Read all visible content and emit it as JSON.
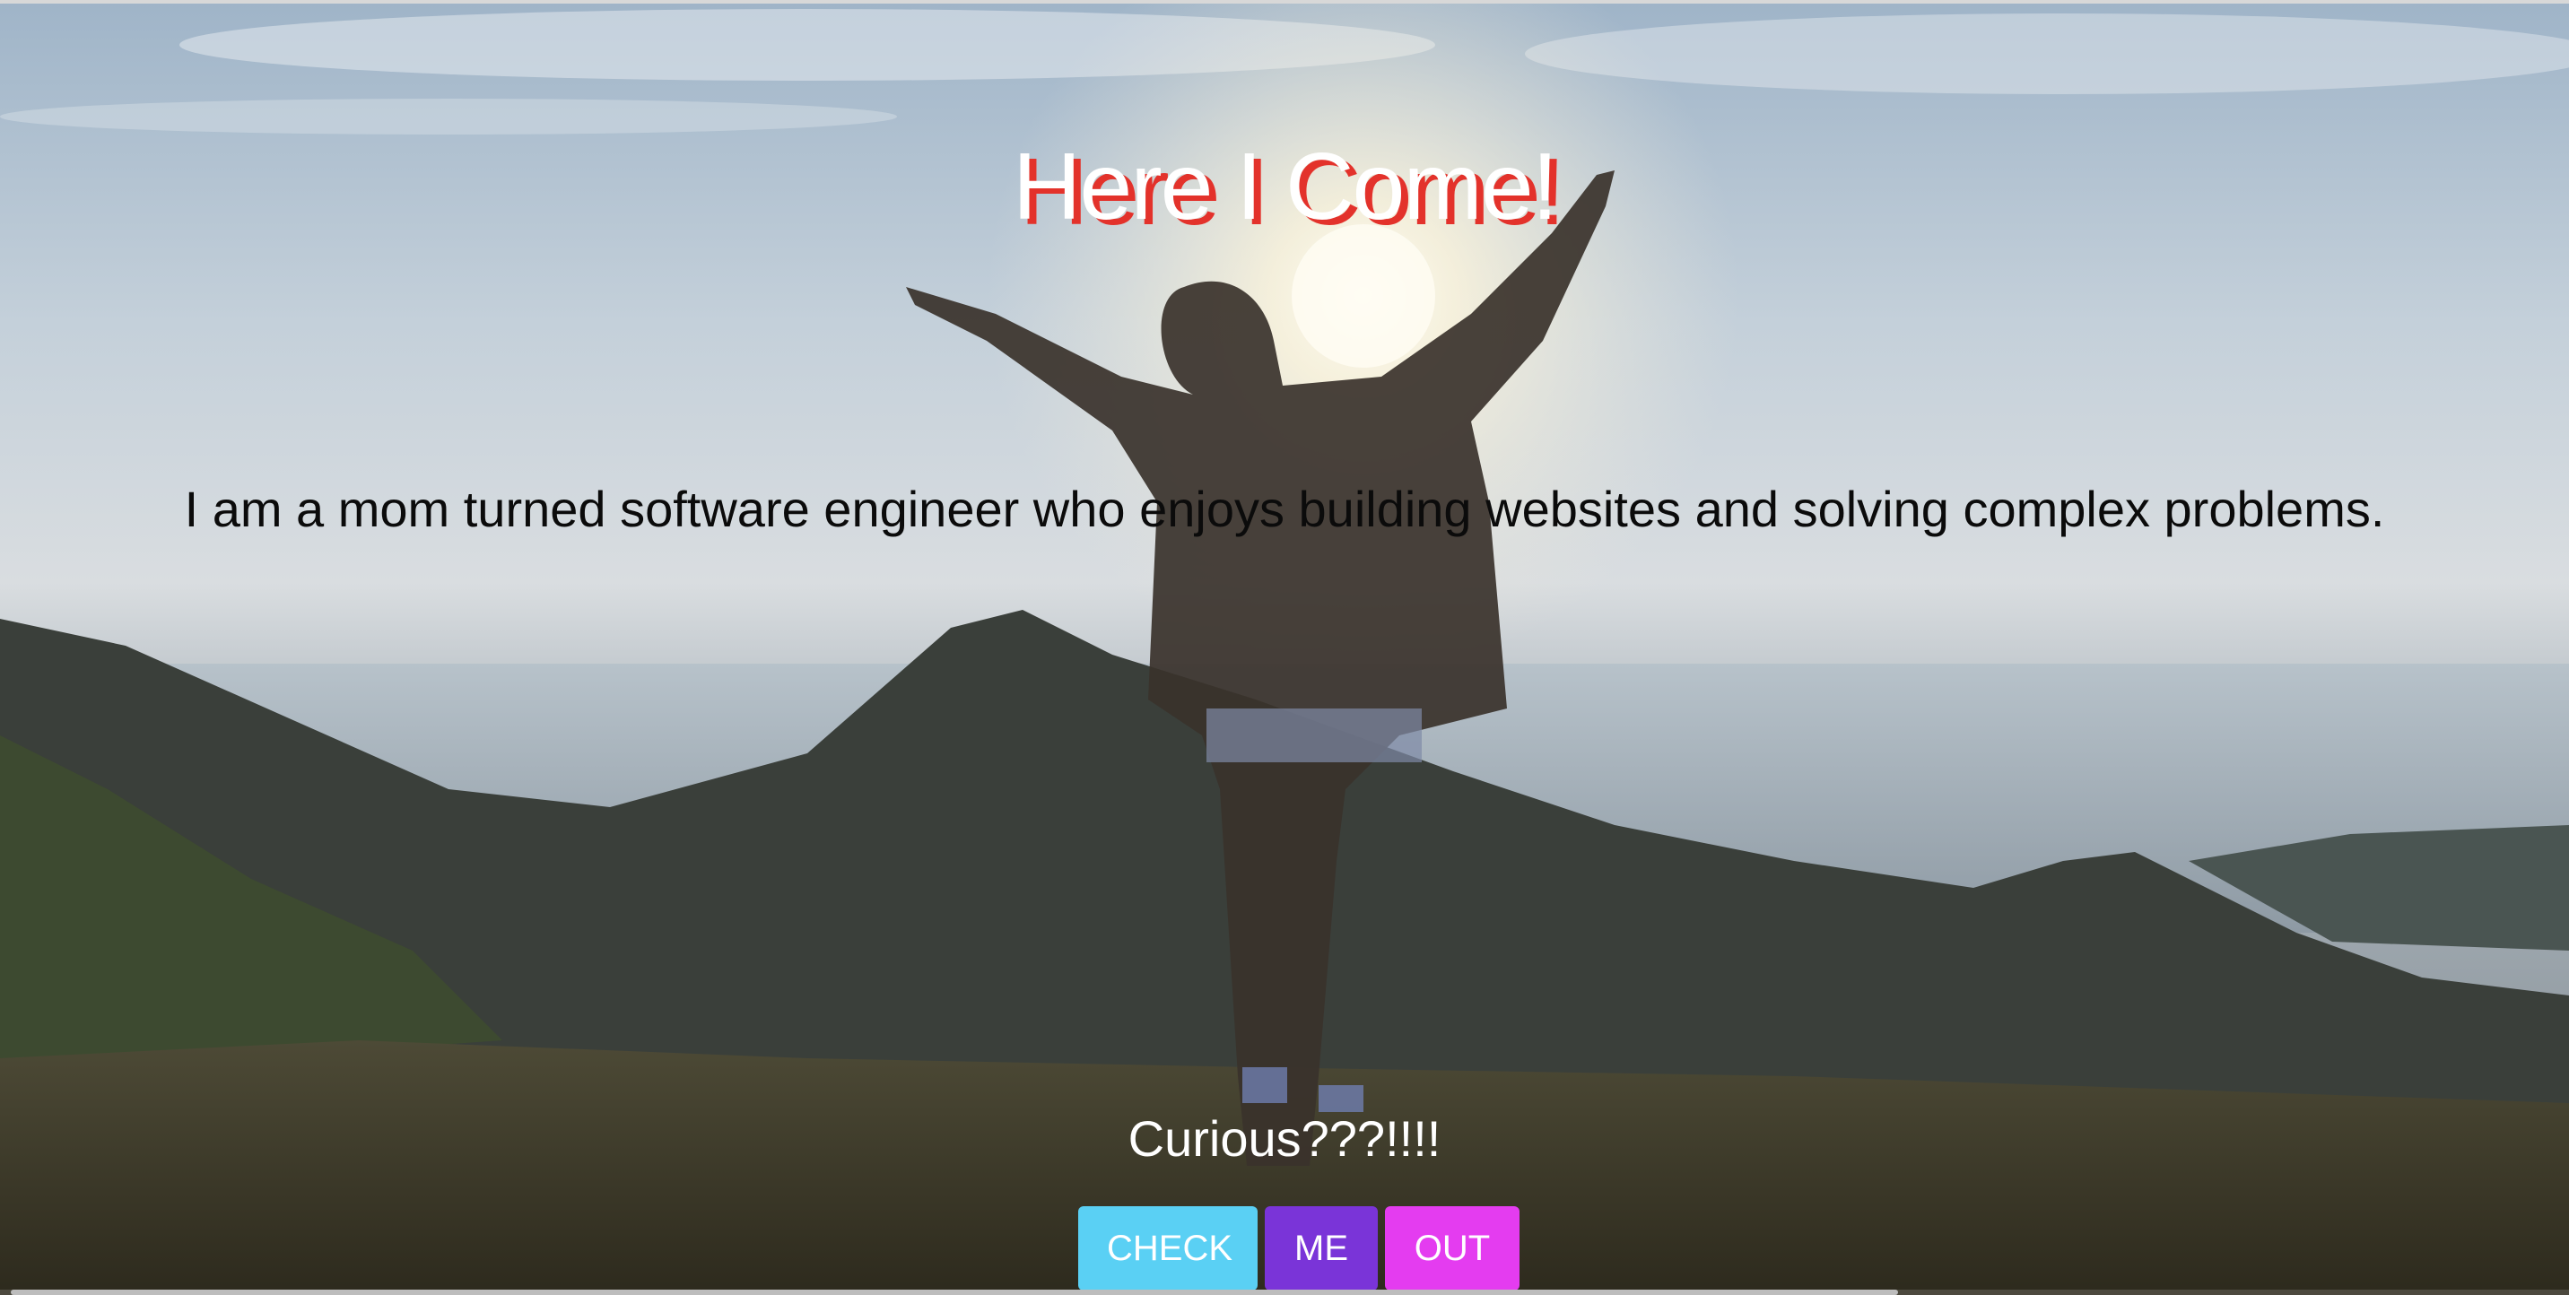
{
  "hero": {
    "headline": "Here I Come!",
    "bio": "I am a mom turned software engineer who enjoys building websites and solving complex problems.",
    "curious": "Curious???!!!!",
    "image_description_icon": "mountain-sunrise-photo"
  },
  "buttons": [
    {
      "label": "CHECK",
      "color": "#5ad0f4"
    },
    {
      "label": "ME",
      "color": "#7a34d8"
    },
    {
      "label": "OUT",
      "color": "#e43cf0"
    }
  ],
  "colors": {
    "headline_shadow": "#e3322b",
    "headline_text": "#ffffff",
    "bio_text": "#0b0b0b"
  }
}
